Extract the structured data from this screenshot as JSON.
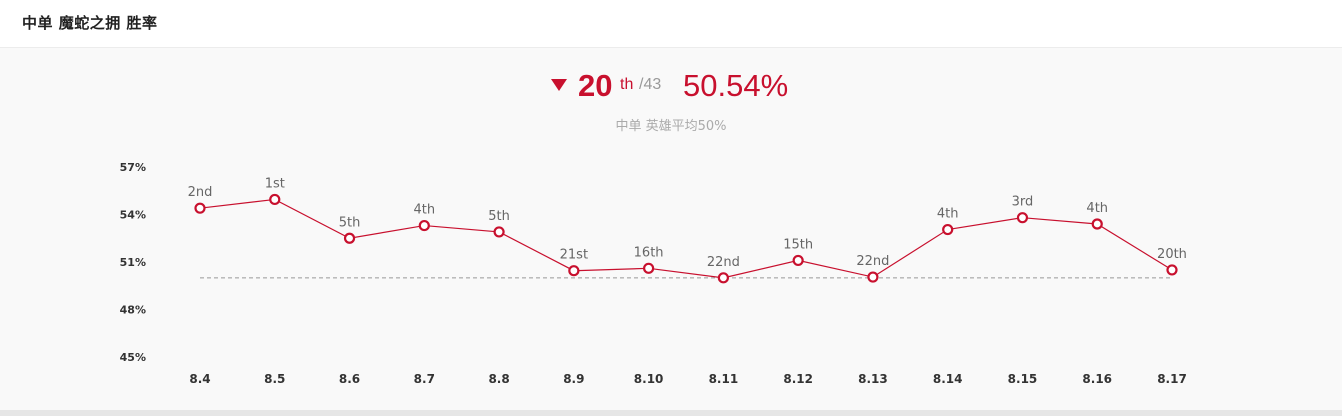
{
  "header": {
    "title": "中单 魔蛇之拥 胜率"
  },
  "summary": {
    "rank": "20",
    "rank_suffix": "th",
    "rank_total": "/43",
    "win_rate": "50.54%",
    "subtitle": "中单 英雄平均50%",
    "trend": "down"
  },
  "colors": {
    "accent": "#c8102e",
    "muted": "#999999",
    "baseline": "#999999"
  },
  "chart_data": {
    "type": "line",
    "title": "",
    "xlabel": "",
    "ylabel": "",
    "categories": [
      "8.4",
      "8.5",
      "8.6",
      "8.7",
      "8.8",
      "8.9",
      "8.10",
      "8.11",
      "8.12",
      "8.13",
      "8.14",
      "8.15",
      "8.16",
      "8.17"
    ],
    "series": [
      {
        "values": [
          54.4,
          54.95,
          52.5,
          53.3,
          52.9,
          50.45,
          50.6,
          50.0,
          51.1,
          50.05,
          53.05,
          53.8,
          53.4,
          50.5
        ],
        "point_labels": [
          "2nd",
          "1st",
          "5th",
          "4th",
          "5th",
          "21st",
          "16th",
          "22nd",
          "15th",
          "22nd",
          "4th",
          "3rd",
          "4th",
          "20th"
        ]
      }
    ],
    "reference_line": 50,
    "ylim": [
      45,
      57
    ],
    "yticks": [
      45,
      48,
      51,
      54,
      57
    ],
    "ytick_labels": [
      "45%",
      "48%",
      "51%",
      "54%",
      "57%"
    ],
    "grid": false,
    "legend": "none"
  }
}
